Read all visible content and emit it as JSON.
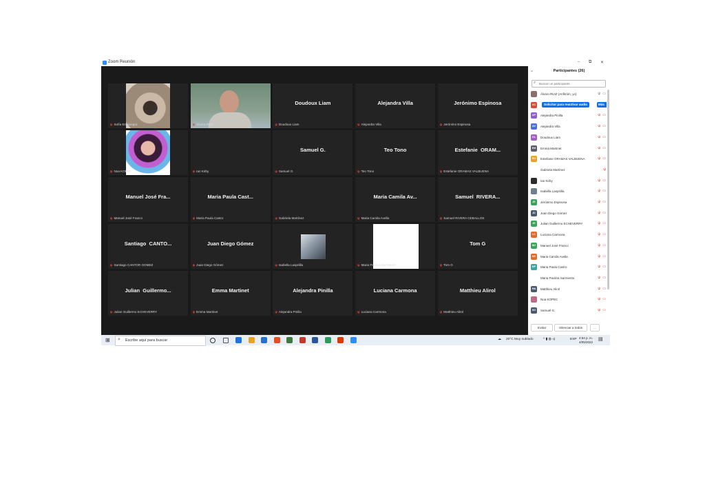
{
  "window": {
    "title": "Zoom Reunión"
  },
  "tiles": [
    {
      "name": "",
      "label": "Sofía Escanegra",
      "speaking": false,
      "pic": "pug"
    },
    {
      "name": "",
      "label": "Álvaro RUIZ",
      "speaking": true,
      "pic": "man"
    },
    {
      "name": "Doudoux Liam",
      "label": "Doudoux Liam",
      "speaking": false,
      "pic": ""
    },
    {
      "name": "Alejandra Villa",
      "label": "Alejandra Villa",
      "speaking": false,
      "pic": ""
    },
    {
      "name": "Jerónimo Espinosa",
      "label": "Jerónimo Espinosa",
      "speaking": false,
      "pic": ""
    },
    {
      "name": "",
      "label": "Noa KOPEC",
      "speaking": false,
      "pic": "art"
    },
    {
      "name": "",
      "label": "Ian Kirby",
      "speaking": false,
      "pic": ""
    },
    {
      "name": "Samuel G.",
      "label": "Samuel G.",
      "speaking": false,
      "pic": ""
    },
    {
      "name": "Teo Tono",
      "label": "Teo Tono",
      "speaking": false,
      "pic": ""
    },
    {
      "name": "Estefanie  ORAM...",
      "label": "Estefanie ORAMAS VALBUENA",
      "speaking": false,
      "pic": ""
    },
    {
      "name": "Manuel José Fra...",
      "label": "Manuel José Franco",
      "speaking": false,
      "pic": ""
    },
    {
      "name": "Maria Paula Cast...",
      "label": "Maria Paula Castro",
      "speaking": false,
      "pic": ""
    },
    {
      "name": "",
      "label": "Gabriela Martínez",
      "speaking": false,
      "pic": ""
    },
    {
      "name": "Maria Camila Av...",
      "label": "Maria Camila Avella",
      "speaking": false,
      "pic": ""
    },
    {
      "name": "Samuel  RIVERA...",
      "label": "Samuel RIVERA CEBALLOS",
      "speaking": false,
      "pic": ""
    },
    {
      "name": "Santiago  CANTO...",
      "label": "Santiago CANTOR GOMEZ",
      "speaking": false,
      "pic": ""
    },
    {
      "name": "Juan Diego Gómez",
      "label": "Juan Diego Gómez",
      "speaking": false,
      "pic": ""
    },
    {
      "name": "",
      "label": "Isabella Laspriilla",
      "speaking": false,
      "pic": "room"
    },
    {
      "name": "",
      "label": "Maria Paulina Sarmiento",
      "speaking": false,
      "pic": "white"
    },
    {
      "name": "Tom G",
      "label": "Tom G",
      "speaking": false,
      "pic": ""
    },
    {
      "name": "Julian  Guillermo...",
      "label": "Julian Guillermo ECHEVERRY",
      "speaking": false,
      "pic": ""
    },
    {
      "name": "Emma Martinet",
      "label": "Emma Martinet",
      "speaking": false,
      "pic": ""
    },
    {
      "name": "Alejandra Pinilla",
      "label": "Alejandra Pinilla",
      "speaking": false,
      "pic": ""
    },
    {
      "name": "Luciana Carmona",
      "label": "Luciana Carmona",
      "speaking": false,
      "pic": ""
    },
    {
      "name": "Matthieu Alirol",
      "label": "Matthieu Alirol",
      "speaking": false,
      "pic": ""
    }
  ],
  "panel": {
    "header": "Participantes (26)",
    "search_placeholder": "Buscar un participante",
    "request_audio_label": "Solicitar para reactivar audio",
    "more_label": "Más",
    "invite_label": "Invitar",
    "mute_all_label": "Silenciar a todos",
    "more_dots": "...",
    "participants": [
      {
        "initials": "",
        "name": "Álvaro RUIZ (Anfitrión, yo)",
        "color": "#8a6f6a",
        "icons": "ψ ▭",
        "icon_color": "#777777"
      },
      {
        "initials": "AC",
        "name": "",
        "color": "#e0453c",
        "icons": "",
        "request": true
      },
      {
        "initials": "AP",
        "name": "Alejandra Pinilla",
        "color": "#8e5fd0",
        "icons": "ψ ▭"
      },
      {
        "initials": "AV",
        "name": "Alejandra Villa",
        "color": "#4f6fd8",
        "icons": "ψ ▭"
      },
      {
        "initials": "DL",
        "name": "Doudoux Liam",
        "color": "#a35fc9",
        "icons": "ψ ▭"
      },
      {
        "initials": "EM",
        "name": "Emma Martinet",
        "color": "#5b5f6b",
        "icons": "ψ ▭"
      },
      {
        "initials": "EO",
        "name": "Estefanie ORAMAS VALBUENA",
        "color": "#e8a421",
        "icons": "ψ ▭"
      },
      {
        "initials": "",
        "name": "Gabriela Martínez",
        "color": "",
        "icons": "ψ"
      },
      {
        "initials": "",
        "name": "Ian Kirby",
        "color": "#2a2a2a",
        "icons": "ψ ▭"
      },
      {
        "initials": "",
        "name": "Isabella Laspriilla",
        "color": "#6f7f8f",
        "icons": "ψ ▭"
      },
      {
        "initials": "JE",
        "name": "Jerónimo Espinosa",
        "color": "#3aa55a",
        "icons": "ψ ▭"
      },
      {
        "initials": "JD",
        "name": "Juan Diego Gómez",
        "color": "#4a5a70",
        "icons": "ψ ▭"
      },
      {
        "initials": "JE",
        "name": "Julian Guillermo ECHEVERRY",
        "color": "#3aa55a",
        "icons": "ψ ▭"
      },
      {
        "initials": "LC",
        "name": "Luciana Carmona",
        "color": "#e06a2c",
        "icons": "ψ ▭"
      },
      {
        "initials": "MJ",
        "name": "Manuel José Franco",
        "color": "#3aa55a",
        "icons": "ψ ▭"
      },
      {
        "initials": "MC",
        "name": "Maria Camila Avella",
        "color": "#e06a2c",
        "icons": "ψ ▭"
      },
      {
        "initials": "MP",
        "name": "Maria Paula Castro",
        "color": "#3aa5a0",
        "icons": "ψ ▭"
      },
      {
        "initials": "",
        "name": "Maria Paulina Sarmiento",
        "color": "",
        "icons": "ψ ▭"
      },
      {
        "initials": "MA",
        "name": "Matthieu Alirol",
        "color": "#4a5a70",
        "icons": "ψ ▭"
      },
      {
        "initials": "",
        "name": "Noa KOPEC",
        "color": "#c06a8a",
        "icons": "ψ ▭"
      },
      {
        "initials": "SG",
        "name": "Samuel G.",
        "color": "#4a5a70",
        "icons": "ψ ▭"
      }
    ]
  },
  "taskbar": {
    "search_placeholder": "Escribe aquí para buscar",
    "weather": "20°C  Muy nublado",
    "language": "ESP",
    "time": "4:54 p. m.",
    "date": "4/05/2022",
    "apps": [
      "#333333",
      "#555555",
      "#1e73d8",
      "#e8a421",
      "#2a6fd0",
      "#e44d26",
      "#3a7a3a",
      "#c0392b",
      "#2b579a",
      "#2e9a5e",
      "#d83b01",
      "#2d8cff"
    ]
  }
}
